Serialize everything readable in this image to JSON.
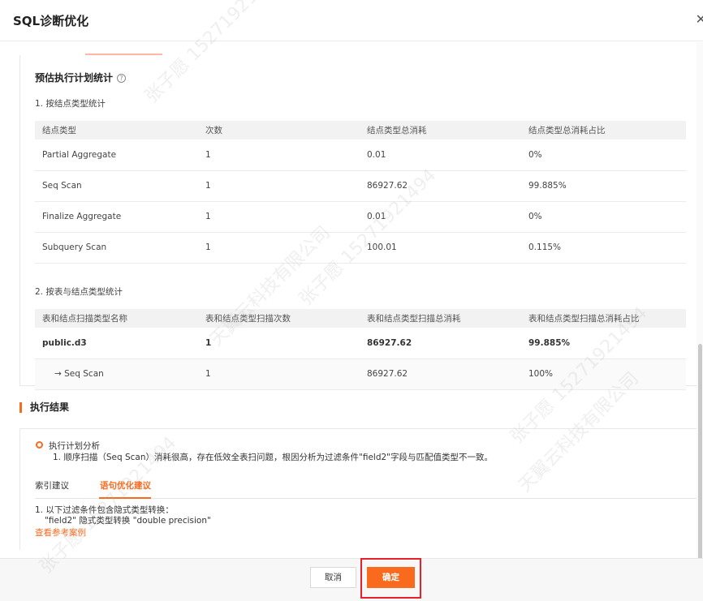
{
  "dialog": {
    "title": "SQL诊断优化",
    "close_icon": "close-icon"
  },
  "stats": {
    "title": "预估执行计划统计",
    "help_icon": "?",
    "section1": "1. 按结点类型统计",
    "table1": {
      "headers": [
        "结点类型",
        "次数",
        "结点类型总消耗",
        "结点类型总消耗占比"
      ],
      "rows": [
        [
          "Partial Aggregate",
          "1",
          "0.01",
          "0%"
        ],
        [
          "Seq Scan",
          "1",
          "86927.62",
          "99.885%"
        ],
        [
          "Finalize Aggregate",
          "1",
          "0.01",
          "0%"
        ],
        [
          "Subquery Scan",
          "1",
          "100.01",
          "0.115%"
        ]
      ]
    },
    "section2": "2. 按表与结点类型统计",
    "table2": {
      "headers": [
        "表和结点扫描类型名称",
        "表和结点类型扫描次数",
        "表和结点类型扫描总消耗",
        "表和结点类型扫描总消耗占比"
      ],
      "rows": [
        [
          "public.d3",
          "1",
          "86927.62",
          "99.885%"
        ],
        [
          "→ Seq Scan",
          "1",
          "86927.62",
          "100%"
        ]
      ]
    }
  },
  "execution": {
    "title": "执行结果",
    "analysis_label": "执行计划分析",
    "analysis_text": "1. 顺序扫描（Seq Scan）消耗很高，存在低效全表扫问题，根因分析为过滤条件\"field2\"字段与匹配值类型不一致。",
    "tabs": [
      "索引建议",
      "语句优化建议"
    ],
    "active_tab": "语句优化建议",
    "suggestion_line1": "1. 以下过滤条件包含隐式类型转换：",
    "suggestion_line2": "\"field2\" 隐式类型转换 \"double precision\"",
    "link": "查看参考案例"
  },
  "footer": {
    "cancel": "取消",
    "confirm": "确定"
  },
  "watermark": {
    "company": "天翼云科技有限公司",
    "user": "张子愿 15271921494"
  },
  "colors": {
    "accent": "#fa6a1e",
    "highlight": "#e8202a"
  }
}
